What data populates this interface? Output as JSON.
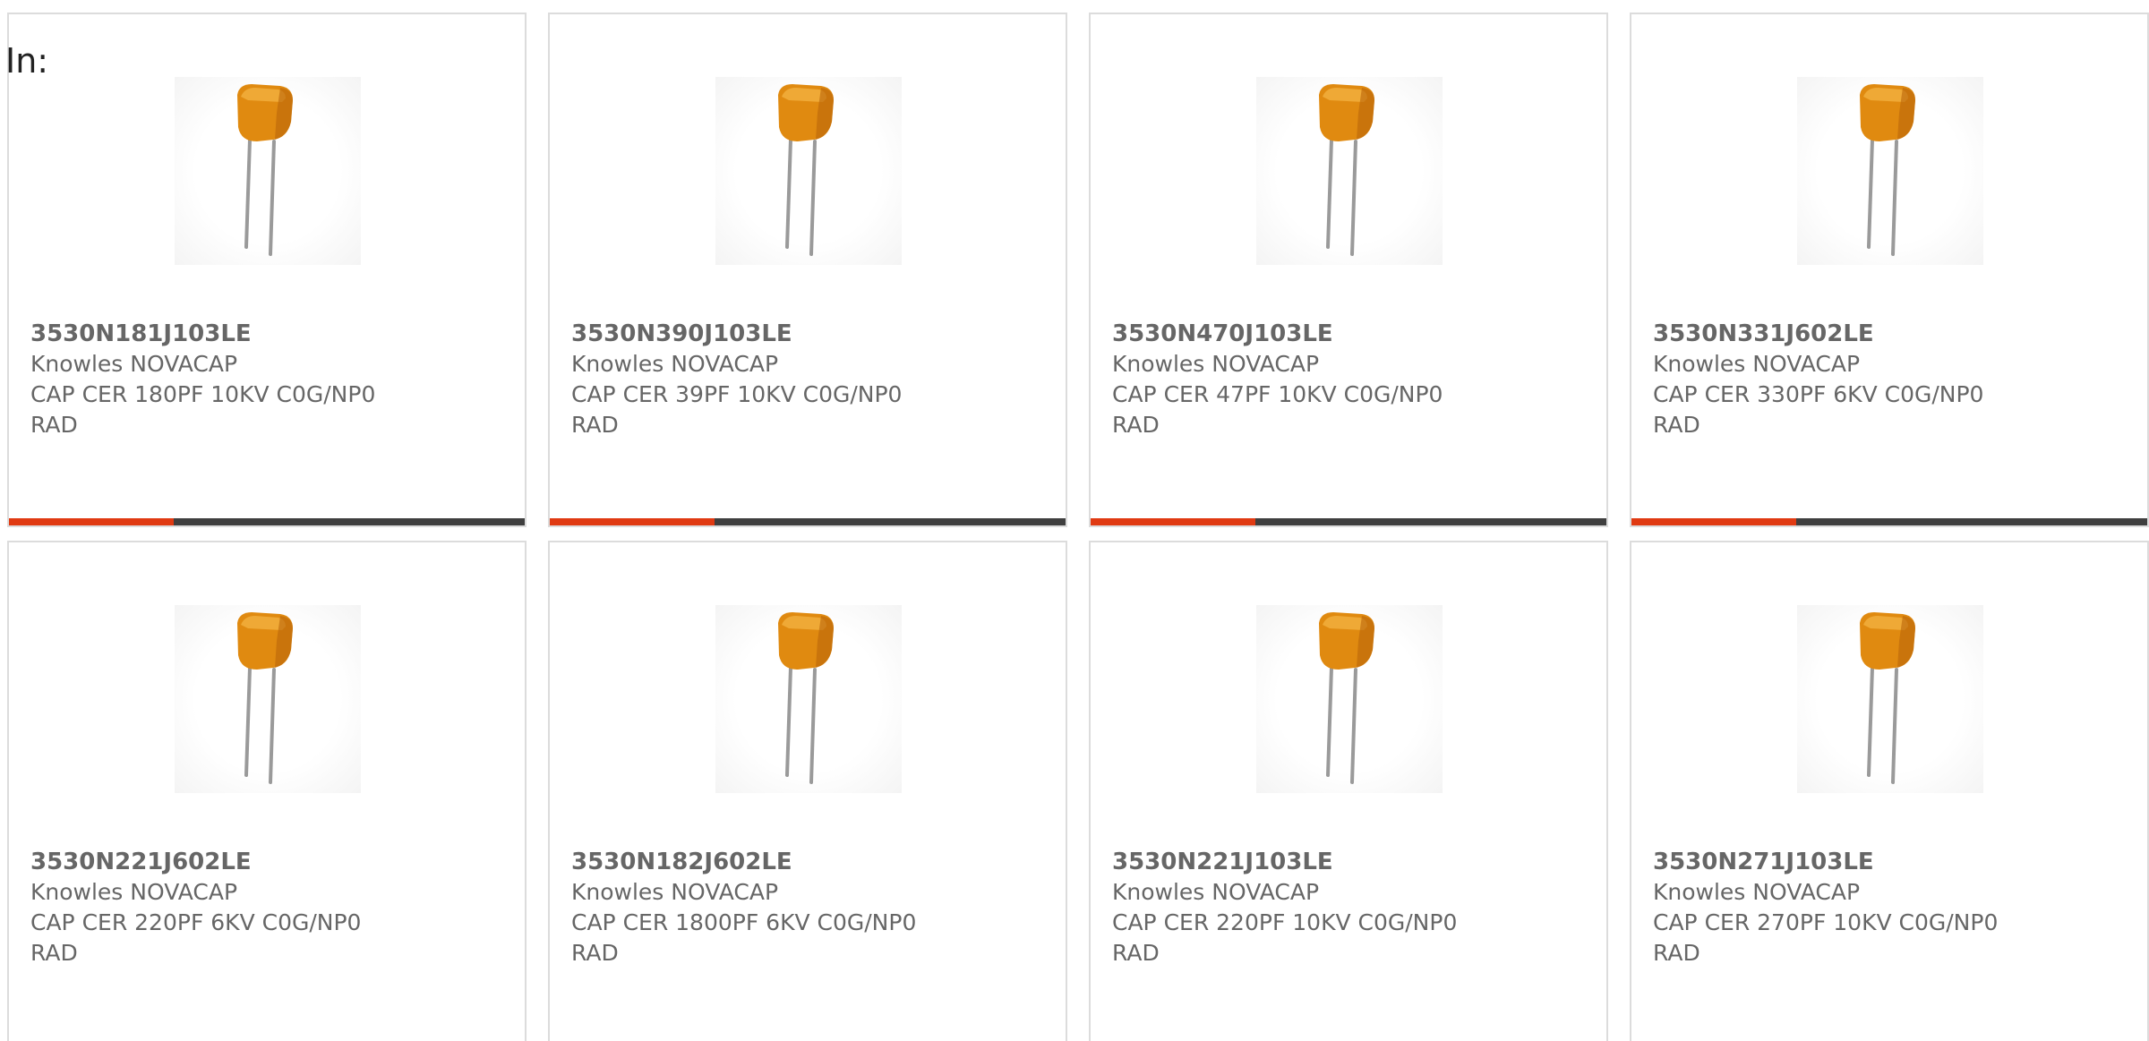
{
  "header": {
    "label": "In:"
  },
  "colors": {
    "accent": "#e03a12",
    "track": "#3f3f3f",
    "body_orange": "#e08a10"
  },
  "products": [
    {
      "part_number": "3530N181J103LE",
      "manufacturer": "Knowles NOVACAP",
      "description": "CAP CER 180PF 10KV C0G/NP0",
      "package": "RAD",
      "icon": "capacitor-image",
      "progress": 0.32
    },
    {
      "part_number": "3530N390J103LE",
      "manufacturer": "Knowles NOVACAP",
      "description": "CAP CER 39PF 10KV C0G/NP0",
      "package": "RAD",
      "icon": "capacitor-image",
      "progress": 0.32
    },
    {
      "part_number": "3530N470J103LE",
      "manufacturer": "Knowles NOVACAP",
      "description": "CAP CER 47PF 10KV C0G/NP0",
      "package": "RAD",
      "icon": "capacitor-image",
      "progress": 0.32
    },
    {
      "part_number": "3530N331J602LE",
      "manufacturer": "Knowles NOVACAP",
      "description": "CAP CER 330PF 6KV C0G/NP0",
      "package": "RAD",
      "icon": "capacitor-image",
      "progress": 0.32
    },
    {
      "part_number": "3530N221J602LE",
      "manufacturer": "Knowles NOVACAP",
      "description": "CAP CER 220PF 6KV C0G/NP0",
      "package": "RAD",
      "icon": "capacitor-image"
    },
    {
      "part_number": "3530N182J602LE",
      "manufacturer": "Knowles NOVACAP",
      "description": "CAP CER 1800PF 6KV C0G/NP0",
      "package": "RAD",
      "icon": "capacitor-image"
    },
    {
      "part_number": "3530N221J103LE",
      "manufacturer": "Knowles NOVACAP",
      "description": "CAP CER 220PF 10KV C0G/NP0",
      "package": "RAD",
      "icon": "capacitor-image"
    },
    {
      "part_number": "3530N271J103LE",
      "manufacturer": "Knowles NOVACAP",
      "description": "CAP CER 270PF 10KV C0G/NP0",
      "package": "RAD",
      "icon": "capacitor-image"
    }
  ]
}
